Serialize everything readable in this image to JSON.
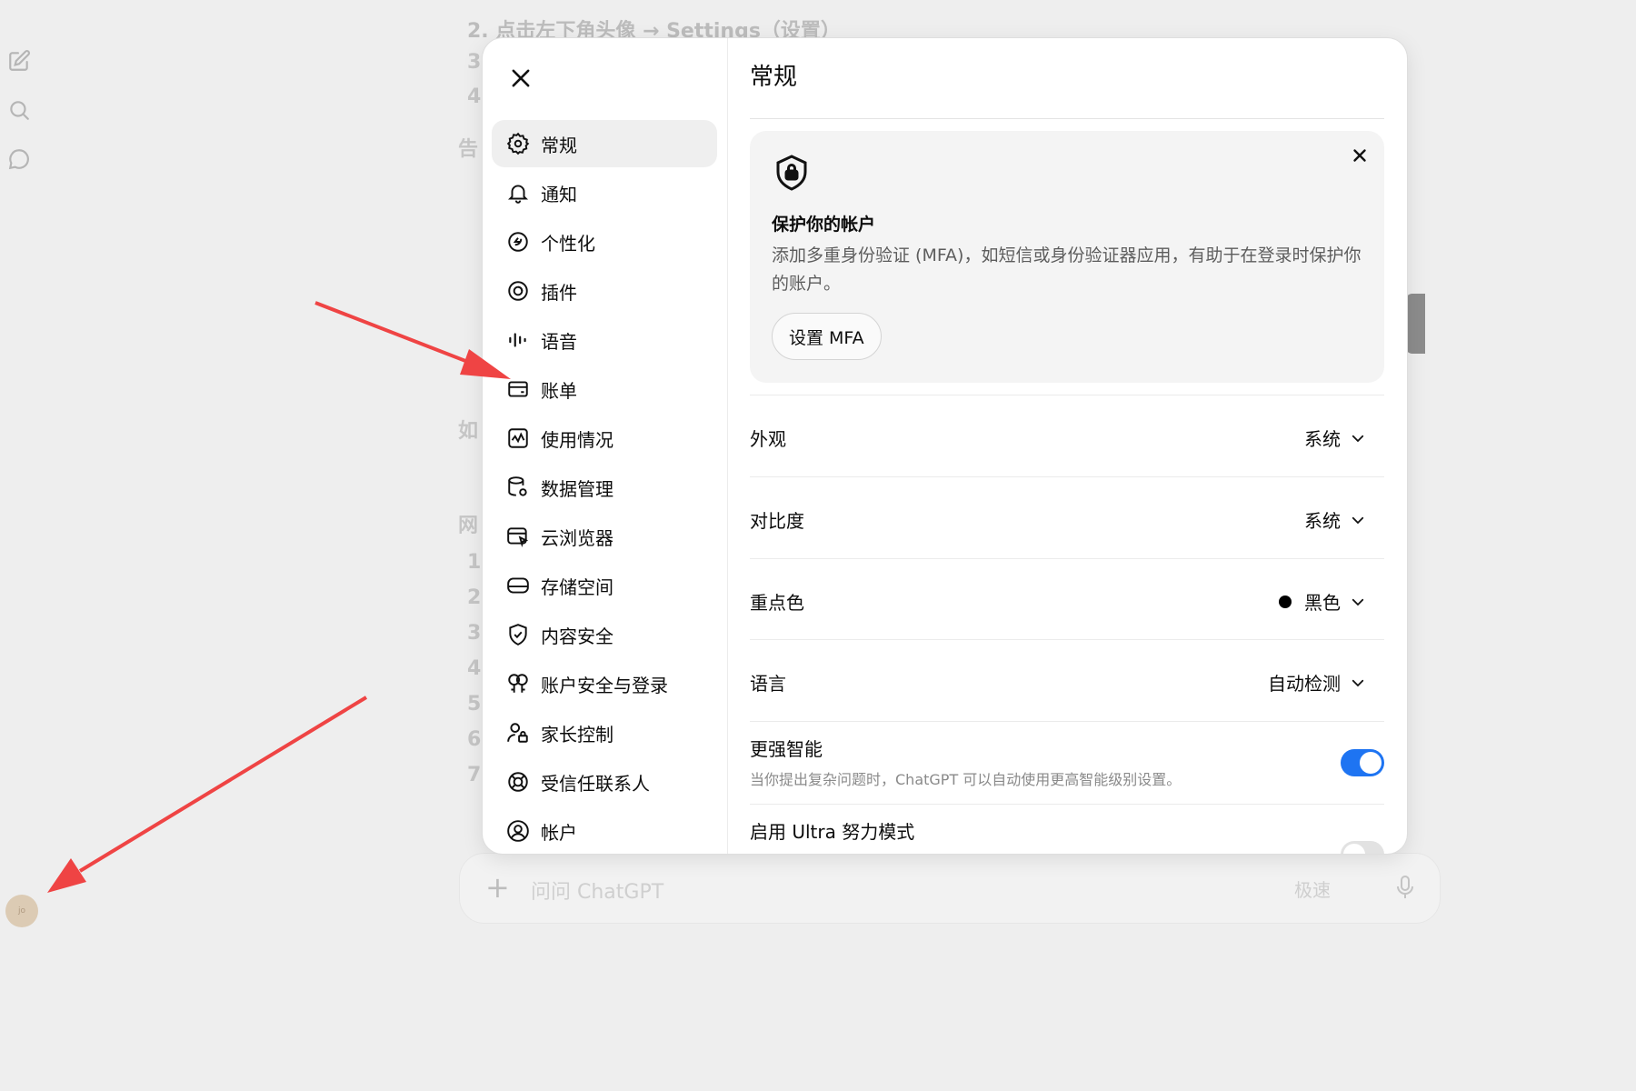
{
  "background": {
    "step_2": "2. 点击左下角头像 → Settings（设置）",
    "fragments": [
      "3",
      "4",
      "告",
      "如",
      "网",
      "1",
      "2",
      "3",
      "4",
      "5",
      "6",
      "7"
    ],
    "avatar_initials": "jo",
    "composer": {
      "placeholder": "问问 ChatGPT",
      "speed_label": "极速"
    }
  },
  "settings": {
    "nav": [
      {
        "label": "常规",
        "icon": "gear-icon",
        "active": true
      },
      {
        "label": "通知",
        "icon": "bell-icon"
      },
      {
        "label": "个性化",
        "icon": "personalization-icon"
      },
      {
        "label": "插件",
        "icon": "plugin-icon"
      },
      {
        "label": "语音",
        "icon": "voice-waveform-icon"
      },
      {
        "label": "账单",
        "icon": "billing-card-icon"
      },
      {
        "label": "使用情况",
        "icon": "usage-chart-icon"
      },
      {
        "label": "数据管理",
        "icon": "database-gear-icon"
      },
      {
        "label": "云浏览器",
        "icon": "cloud-browser-icon"
      },
      {
        "label": "存储空间",
        "icon": "storage-drive-icon"
      },
      {
        "label": "内容安全",
        "icon": "shield-check-icon"
      },
      {
        "label": "账户安全与登录",
        "icon": "security-login-icon"
      },
      {
        "label": "家长控制",
        "icon": "parental-control-icon"
      },
      {
        "label": "受信任联系人",
        "icon": "trusted-contact-icon"
      },
      {
        "label": "帐户",
        "icon": "account-icon"
      }
    ],
    "page_title": "常规",
    "mfa_card": {
      "title": "保护你的帐户",
      "description": "添加多重身份验证 (MFA)，如短信或身份验证器应用，有助于在登录时保护你的账户。",
      "button_label": "设置 MFA"
    },
    "rows": {
      "appearance": {
        "label": "外观",
        "value": "系统"
      },
      "contrast": {
        "label": "对比度",
        "value": "系统"
      },
      "accent": {
        "label": "重点色",
        "value": "黑色",
        "color": "#000000"
      },
      "language": {
        "label": "语言",
        "value": "自动检测"
      },
      "stronger_intelligence": {
        "label": "更强智能",
        "description": "当你提出复杂问题时，ChatGPT 可以自动使用更高智能级别设置。",
        "enabled": true
      },
      "ultra_mode": {
        "label": "启用 Ultra 努力模式",
        "enabled": false
      }
    }
  },
  "colors": {
    "toggle_on": "#1e74f2",
    "arrow": "#ef4444"
  }
}
